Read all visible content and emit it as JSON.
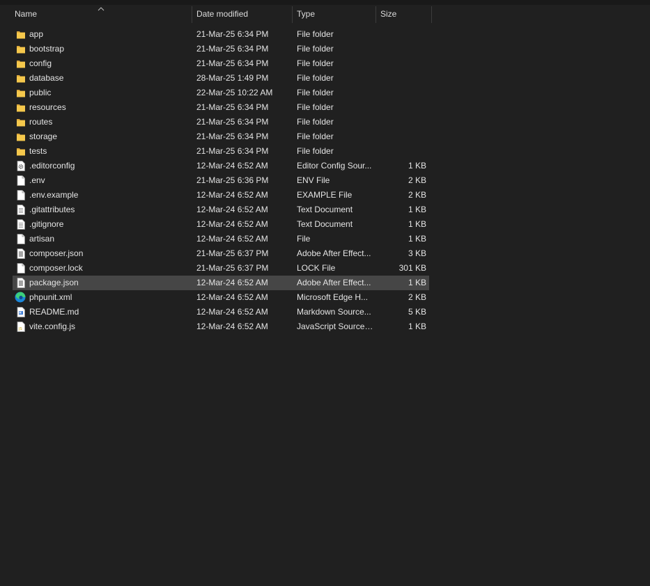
{
  "columns": {
    "name": "Name",
    "date": "Date modified",
    "type": "Type",
    "size": "Size"
  },
  "selected_index": 17,
  "files": [
    {
      "name": "app",
      "date": "21-Mar-25 6:34 PM",
      "type": "File folder",
      "size": "",
      "icon": "folder-icon"
    },
    {
      "name": "bootstrap",
      "date": "21-Mar-25 6:34 PM",
      "type": "File folder",
      "size": "",
      "icon": "folder-icon"
    },
    {
      "name": "config",
      "date": "21-Mar-25 6:34 PM",
      "type": "File folder",
      "size": "",
      "icon": "folder-icon"
    },
    {
      "name": "database",
      "date": "28-Mar-25 1:49 PM",
      "type": "File folder",
      "size": "",
      "icon": "folder-icon"
    },
    {
      "name": "public",
      "date": "22-Mar-25 10:22 AM",
      "type": "File folder",
      "size": "",
      "icon": "folder-icon"
    },
    {
      "name": "resources",
      "date": "21-Mar-25 6:34 PM",
      "type": "File folder",
      "size": "",
      "icon": "folder-icon"
    },
    {
      "name": "routes",
      "date": "21-Mar-25 6:34 PM",
      "type": "File folder",
      "size": "",
      "icon": "folder-icon"
    },
    {
      "name": "storage",
      "date": "21-Mar-25 6:34 PM",
      "type": "File folder",
      "size": "",
      "icon": "folder-icon"
    },
    {
      "name": "tests",
      "date": "21-Mar-25 6:34 PM",
      "type": "File folder",
      "size": "",
      "icon": "folder-icon"
    },
    {
      "name": ".editorconfig",
      "date": "12-Mar-24 6:52 AM",
      "type": "Editor Config Sour...",
      "size": "1 KB",
      "icon": "gear-file-icon"
    },
    {
      "name": ".env",
      "date": "21-Mar-25 6:36 PM",
      "type": "ENV File",
      "size": "2 KB",
      "icon": "blank-file-icon"
    },
    {
      "name": ".env.example",
      "date": "12-Mar-24 6:52 AM",
      "type": "EXAMPLE File",
      "size": "2 KB",
      "icon": "blank-file-icon"
    },
    {
      "name": ".gitattributes",
      "date": "12-Mar-24 6:52 AM",
      "type": "Text Document",
      "size": "1 KB",
      "icon": "text-file-icon"
    },
    {
      "name": ".gitignore",
      "date": "12-Mar-24 6:52 AM",
      "type": "Text Document",
      "size": "1 KB",
      "icon": "text-file-icon"
    },
    {
      "name": "artisan",
      "date": "12-Mar-24 6:52 AM",
      "type": "File",
      "size": "1 KB",
      "icon": "blank-file-icon"
    },
    {
      "name": "composer.json",
      "date": "21-Mar-25 6:37 PM",
      "type": "Adobe After Effect...",
      "size": "3 KB",
      "icon": "list-file-icon"
    },
    {
      "name": "composer.lock",
      "date": "21-Mar-25 6:37 PM",
      "type": "LOCK File",
      "size": "301 KB",
      "icon": "blank-file-icon"
    },
    {
      "name": "package.json",
      "date": "12-Mar-24 6:52 AM",
      "type": "Adobe After Effect...",
      "size": "1 KB",
      "icon": "list-file-icon"
    },
    {
      "name": "phpunit.xml",
      "date": "12-Mar-24 6:52 AM",
      "type": "Microsoft Edge H...",
      "size": "2 KB",
      "icon": "edge-icon"
    },
    {
      "name": "README.md",
      "date": "12-Mar-24 6:52 AM",
      "type": "Markdown Source...",
      "size": "5 KB",
      "icon": "markdown-file-icon"
    },
    {
      "name": "vite.config.js",
      "date": "12-Mar-24 6:52 AM",
      "type": "JavaScript Source ...",
      "size": "1 KB",
      "icon": "js-file-icon"
    }
  ],
  "colors": {
    "background": "#202020",
    "selected_row": "#464646",
    "folder": "#f5c84c",
    "text": "#e4e4e4"
  }
}
